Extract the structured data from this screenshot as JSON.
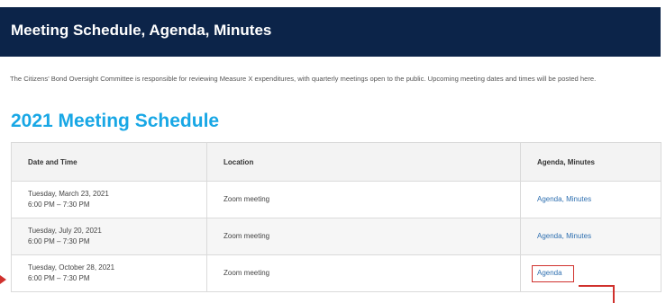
{
  "banner": {
    "title": "Meeting Schedule, Agenda, Minutes"
  },
  "intro": {
    "text": "The Citizens' Bond Oversight Committee is responsible for reviewing Measure X expenditures, with quarterly meetings open to the public. Upcoming meeting dates and times will be posted here."
  },
  "section": {
    "title": "2021 Meeting Schedule"
  },
  "table": {
    "headers": [
      "Date and Time",
      "Location",
      "Agenda, Minutes"
    ],
    "rows": [
      {
        "date": "Tuesday, March 23, 2021",
        "time": "6:00 PM – 7:30 PM",
        "location": "Zoom meeting",
        "agenda": "Agenda",
        "sep": ",",
        "minutes": "Minutes"
      },
      {
        "date": "Tuesday, July 20, 2021",
        "time": "6:00 PM – 7:30 PM",
        "location": "Zoom meeting",
        "agenda": "Agenda",
        "sep": ",",
        "minutes": "Minutes"
      },
      {
        "date": "Tuesday, October 28, 2021",
        "time": "6:00 PM – 7:30 PM",
        "location": "Zoom meeting",
        "agenda": "Agenda"
      }
    ]
  },
  "colors": {
    "banner": "#0c2449",
    "heading": "#18a7e5",
    "link": "#2e6fb0",
    "annotation": "#d0312d"
  }
}
